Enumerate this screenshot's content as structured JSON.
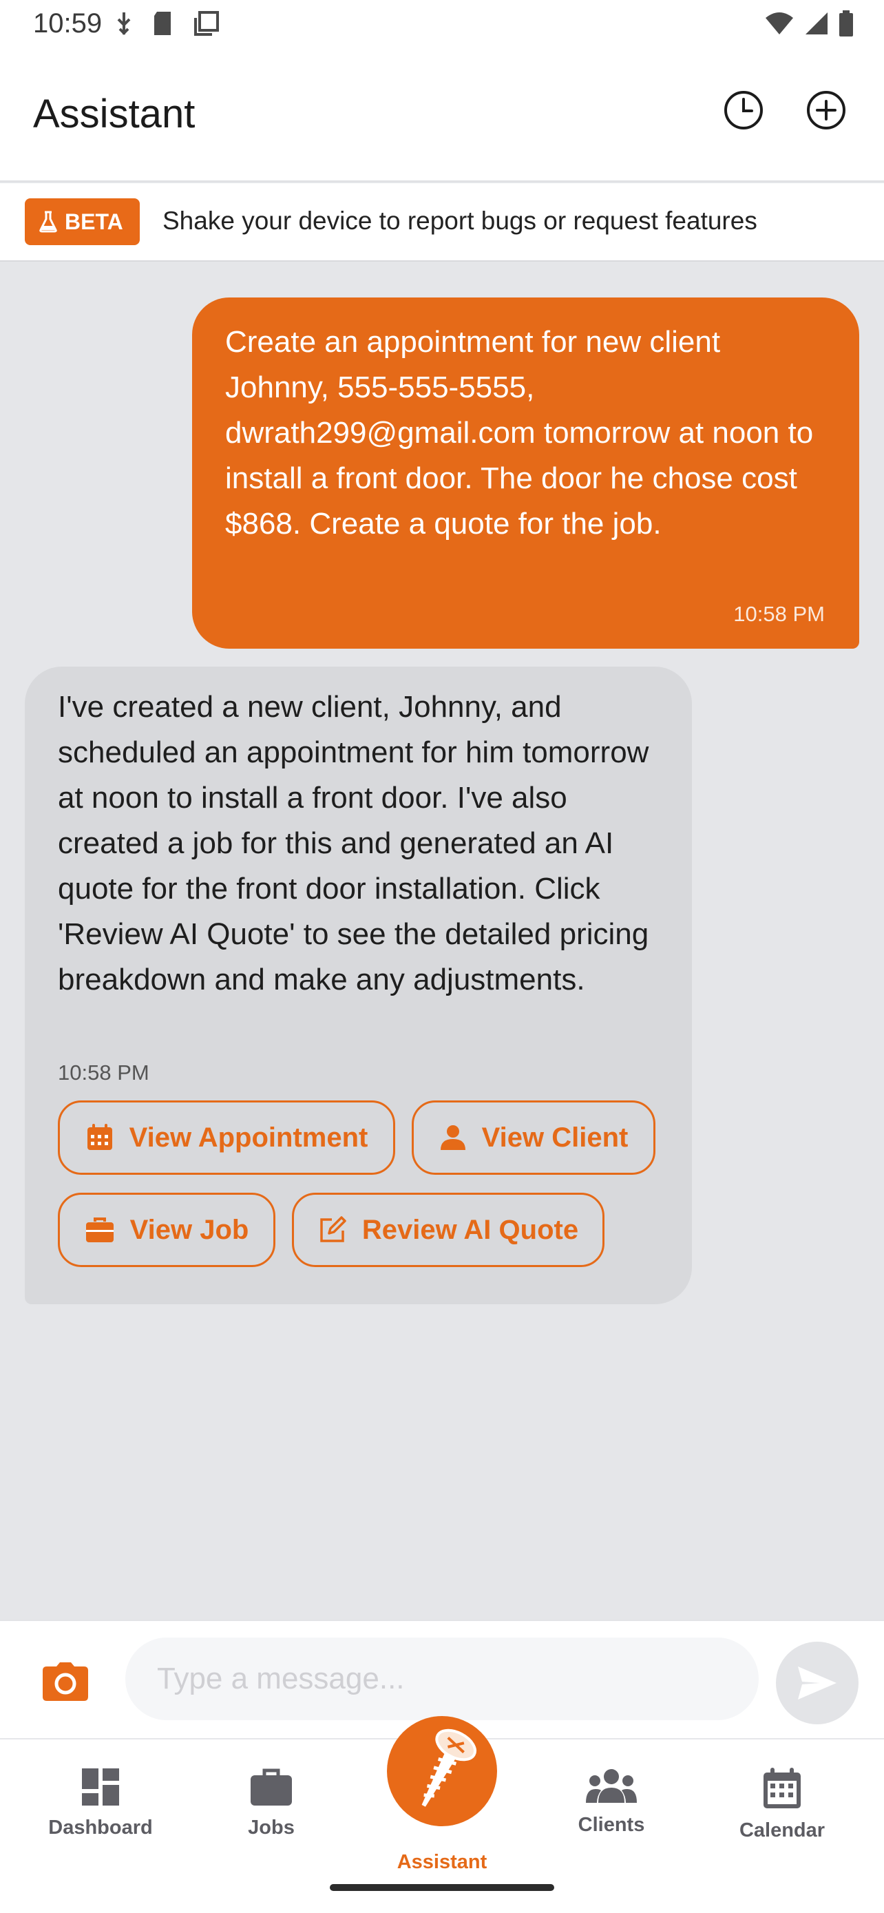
{
  "status_bar": {
    "time": "10:59"
  },
  "header": {
    "title": "Assistant",
    "history_icon": "history-clock-icon",
    "new_chat_icon": "plus-circle-icon"
  },
  "beta": {
    "badge": "BETA",
    "text": "Shake your device to report bugs or request features"
  },
  "messages": {
    "user": {
      "text": "Create an appointment for new client Johnny, 555-555-5555, dwrath299@gmail.com tomorrow at noon to install a front door. The door he chose cost $868. Create a quote for the job.",
      "time": "10:58 PM"
    },
    "assistant": {
      "text": "I've created a new client, Johnny, and scheduled an appointment for him tomorrow at noon to install a front door. I've also created a job for this and generated an AI quote for the front door installation. Click 'Review AI Quote' to see the detailed pricing breakdown and make any adjustments.",
      "time": "10:58 PM",
      "actions": {
        "view_appointment": "View Appointment",
        "view_client": "View Client",
        "view_job": "View Job",
        "review_quote": "Review AI Quote"
      }
    }
  },
  "composer": {
    "placeholder": "Type a message..."
  },
  "nav": {
    "dashboard": "Dashboard",
    "jobs": "Jobs",
    "assistant": "Assistant",
    "clients": "Clients",
    "calendar": "Calendar"
  },
  "colors": {
    "accent": "#e56a18",
    "chat_bg": "#e5e6e9",
    "assistant_bubble": "#d8d9dc"
  }
}
